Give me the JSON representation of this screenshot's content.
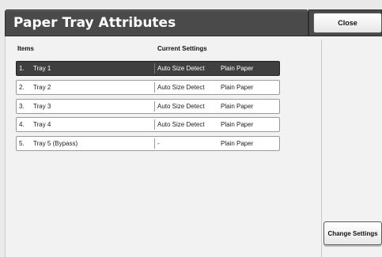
{
  "header": {
    "title": "Paper Tray Attributes",
    "close_label": "Close"
  },
  "columns": {
    "items": "Items",
    "current_settings": "Current Settings"
  },
  "rows": [
    {
      "num": "1.",
      "name": "Tray 1",
      "size": "Auto Size Detect",
      "type": "Plain Paper",
      "selected": true
    },
    {
      "num": "2.",
      "name": "Tray 2",
      "size": "Auto Size Detect",
      "type": "Plain Paper",
      "selected": false
    },
    {
      "num": "3.",
      "name": "Tray 3",
      "size": "Auto Size Detect",
      "type": "Plain Paper",
      "selected": false
    },
    {
      "num": "4.",
      "name": "Tray 4",
      "size": "Auto Size Detect",
      "type": "Plain Paper",
      "selected": false
    },
    {
      "num": "5.",
      "name": "Tray 5 (Bypass)",
      "size": "-",
      "type": "Plain Paper",
      "selected": false
    }
  ],
  "actions": {
    "change_settings_label": "Change Settings"
  },
  "colors": {
    "title_bg": "#4a4a4a",
    "selected_row_bg": "#3f3f3f",
    "panel_bg": "#f2f2f2"
  }
}
